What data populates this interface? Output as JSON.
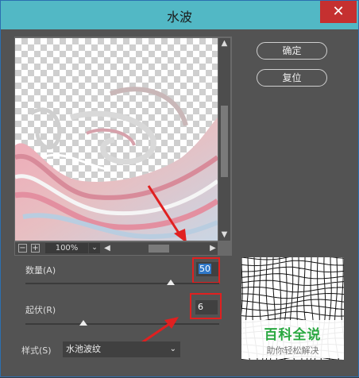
{
  "window": {
    "title": "水波",
    "close_glyph": "✕"
  },
  "buttons": {
    "ok": "确定",
    "reset": "复位"
  },
  "preview": {
    "zoom_out": "−",
    "zoom_in": "+",
    "zoom_value": "100%",
    "dropdown_glyph": "⌄",
    "left_glyph": "◀",
    "right_glyph": "▶",
    "up_glyph": "▲",
    "down_glyph": "▼"
  },
  "amount": {
    "label": "数量(A)",
    "value": "50",
    "slider_fraction": 0.75
  },
  "ridges": {
    "label": "起伏(R)",
    "value": "6",
    "slider_fraction": 0.3
  },
  "style": {
    "label": "样式(S)",
    "value": "水池波纹",
    "dropdown_glyph": "⌄"
  },
  "watermark": {
    "title": "百科全说",
    "subtitle": "助你轻松解决"
  },
  "colors": {
    "title_bar": "#52b8c5",
    "dialog_bg": "#535353",
    "close": "#c53030",
    "annotation": "#e02020",
    "selection": "#2f78c8"
  }
}
